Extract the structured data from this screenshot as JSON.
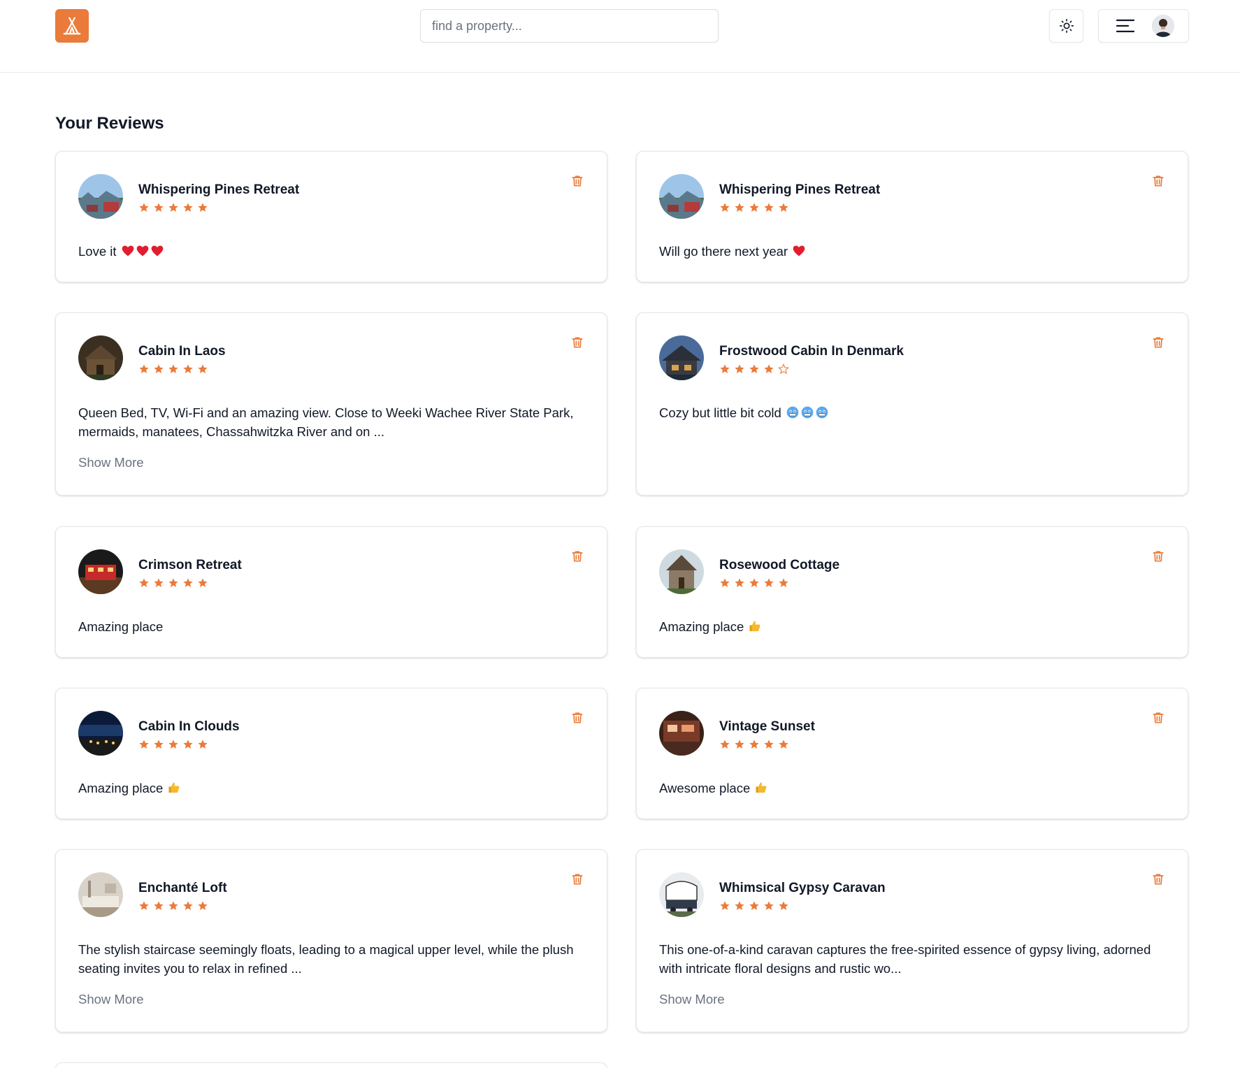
{
  "header": {
    "logo_icon": "tent-icon",
    "search_placeholder": "find a property...",
    "theme_icon": "sun-icon",
    "menu_icon": "menu-lines-icon",
    "accent_color": "#ea7b3a"
  },
  "page": {
    "title": "Your Reviews"
  },
  "reviews": [
    {
      "property": "Whispering Pines Retreat",
      "rating": 5,
      "comment": "Love it",
      "emoji": [
        "heart",
        "heart",
        "heart"
      ],
      "show_more": ""
    },
    {
      "property": "Whispering Pines Retreat",
      "rating": 5,
      "comment": "Will go there next year",
      "emoji": [
        "heart"
      ],
      "show_more": ""
    },
    {
      "property": "Cabin In Laos",
      "rating": 5,
      "comment": "Queen Bed, TV, Wi-Fi and an amazing view. Close to Weeki Wachee River State Park, mermaids, manatees, Chassahwitzka River and on ...",
      "emoji": [],
      "show_more": "Show More"
    },
    {
      "property": "Frostwood Cabin In Denmark",
      "rating": 4,
      "comment": "Cozy but little bit cold",
      "emoji": [
        "cold",
        "cold",
        "cold"
      ],
      "show_more": ""
    },
    {
      "property": "Crimson Retreat",
      "rating": 5,
      "comment": "Amazing place",
      "emoji": [],
      "show_more": ""
    },
    {
      "property": "Rosewood Cottage",
      "rating": 5,
      "comment": "Amazing place",
      "emoji": [
        "thumb"
      ],
      "show_more": ""
    },
    {
      "property": "Cabin In Clouds",
      "rating": 5,
      "comment": "Amazing place",
      "emoji": [
        "thumb"
      ],
      "show_more": ""
    },
    {
      "property": "Vintage Sunset",
      "rating": 5,
      "comment": "Awesome place",
      "emoji": [
        "thumb"
      ],
      "show_more": ""
    },
    {
      "property": "Enchanté Loft",
      "rating": 5,
      "comment": "The stylish staircase seemingly floats, leading to a magical upper level, while the plush seating invites you to relax in refined ...",
      "emoji": [],
      "show_more": "Show More"
    },
    {
      "property": "Whimsical Gypsy Caravan",
      "rating": 5,
      "comment": "This one-of-a-kind caravan captures the free-spirited essence of gypsy living, adorned with intricate floral designs and rustic wo...",
      "emoji": [],
      "show_more": "Show More"
    }
  ]
}
